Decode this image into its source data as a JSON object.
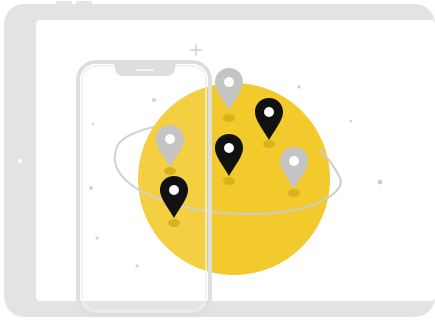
{
  "illustration": {
    "subject": "tablet-and-phone-with-globe-and-location-pins",
    "colors": {
      "device_frame": "#e2e2e2",
      "device_screen": "#ffffff",
      "globe": "#f2ca2c",
      "pin_dark": "#111111",
      "pin_light": "#c4c4c4",
      "pin_shadow": "#d9b21e",
      "orbit": "#cccccc",
      "sparkle": "#d0d0d0"
    },
    "icons": [
      "map-pin-icon",
      "plus-sparkle-icon",
      "dot-sparkle-icon"
    ],
    "pins": [
      {
        "name": "pin-light-top",
        "tone": "light"
      },
      {
        "name": "pin-dark-right",
        "tone": "dark"
      },
      {
        "name": "pin-dark-center",
        "tone": "dark"
      },
      {
        "name": "pin-light-left",
        "tone": "light"
      },
      {
        "name": "pin-light-right",
        "tone": "light"
      },
      {
        "name": "pin-dark-bottom-left",
        "tone": "dark"
      }
    ]
  }
}
